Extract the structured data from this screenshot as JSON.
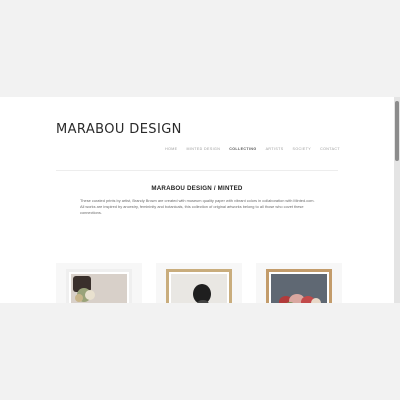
{
  "site": {
    "title": "MARABOU DESIGN",
    "nav": [
      {
        "label": "HOME",
        "active": false
      },
      {
        "label": "MINTED DESIGN",
        "active": false
      },
      {
        "label": "COLLECTING",
        "active": true
      },
      {
        "label": "ARTISTS",
        "active": false
      },
      {
        "label": "SOCIETY",
        "active": false
      },
      {
        "label": "CONTACT",
        "active": false
      }
    ]
  },
  "main": {
    "heading": "MARABOU DESIGN / MINTED",
    "intro": "These curated prints by artist, Brandy Brown are created with museum quality paper with vibrant colors in collaboration with Minted.com. All works are inspired by ancestry, femininity and botanicals, this collection of original artworks belong to all those who covet these connections."
  },
  "products": [
    {
      "art": "floral-still-life-print",
      "frame_color": "#efefef"
    },
    {
      "art": "figure-portrait-print",
      "frame_color": "#c9ad7d"
    },
    {
      "art": "bouquet-print",
      "frame_color": "#c39c6b"
    }
  ]
}
